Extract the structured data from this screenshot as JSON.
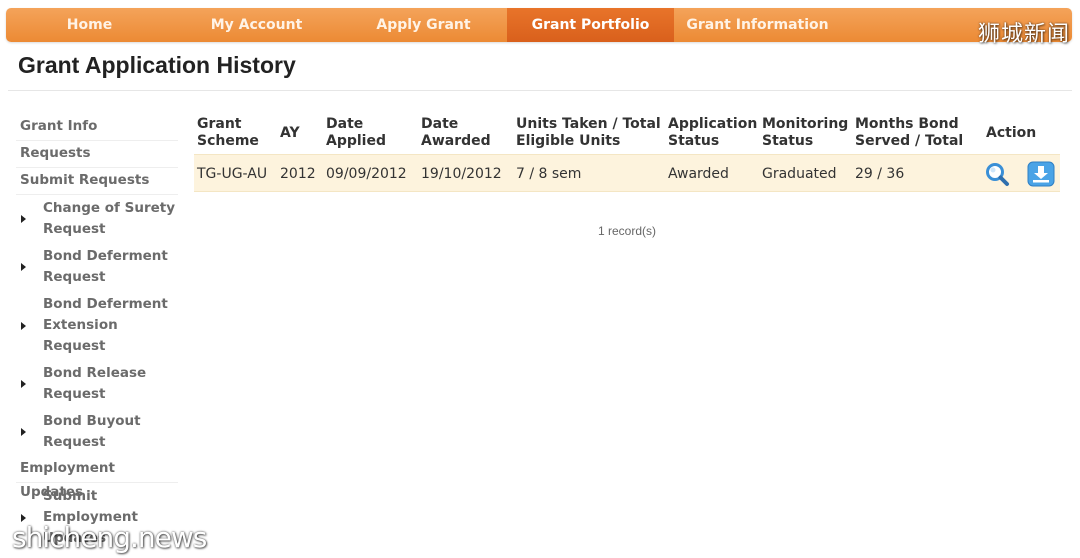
{
  "nav": {
    "items": [
      {
        "label": "Home"
      },
      {
        "label": "My Account"
      },
      {
        "label": "Apply Grant"
      },
      {
        "label": "Grant Portfolio",
        "active": true
      },
      {
        "label": "Grant Information"
      }
    ]
  },
  "page_title": "Grant Application History",
  "sidebar": {
    "grant_info": "Grant Info",
    "requests": "Requests",
    "submit_requests": "Submit Requests",
    "request_items": [
      {
        "label": "Change of Surety Request"
      },
      {
        "label": "Bond Deferment Request"
      },
      {
        "label": "Bond Deferment Extension Request"
      },
      {
        "label": "Bond Release Request"
      },
      {
        "label": "Bond Buyout Request"
      }
    ],
    "employment_updates": "Employment Updates",
    "employment_items": [
      {
        "label": "Submit Employment Updates"
      }
    ]
  },
  "table": {
    "columns": [
      {
        "l1": "Grant",
        "l2": "Scheme"
      },
      {
        "l1": "AY",
        "l2": ""
      },
      {
        "l1": "Date",
        "l2": "Applied"
      },
      {
        "l1": "Date",
        "l2": "Awarded"
      },
      {
        "l1": "Units Taken / Total",
        "l2": "Eligible Units"
      },
      {
        "l1": "Application",
        "l2": "Status"
      },
      {
        "l1": "Monitoring",
        "l2": "Status"
      },
      {
        "l1": "Months Bond",
        "l2": "Served / Total"
      },
      {
        "l1": "Action",
        "l2": ""
      }
    ],
    "rows": [
      {
        "scheme": "TG-UG-AU",
        "ay": "2012",
        "date_applied": "09/09/2012",
        "date_awarded": "19/10/2012",
        "units": "7 / 8 sem",
        "application_status": "Awarded",
        "monitoring_status": "Graduated",
        "months_bond": "29 / 36",
        "actions": [
          "search-icon",
          "download-icon"
        ]
      }
    ],
    "record_count": "1 record(s)"
  },
  "watermarks": {
    "top": "狮城新闻",
    "bottom": "shicheng.news"
  },
  "colors": {
    "nav_orange": "#ec8a34",
    "nav_active": "#d9601c",
    "row_highlight": "#fdf3dd",
    "icon_blue": "#3a8fd6"
  }
}
